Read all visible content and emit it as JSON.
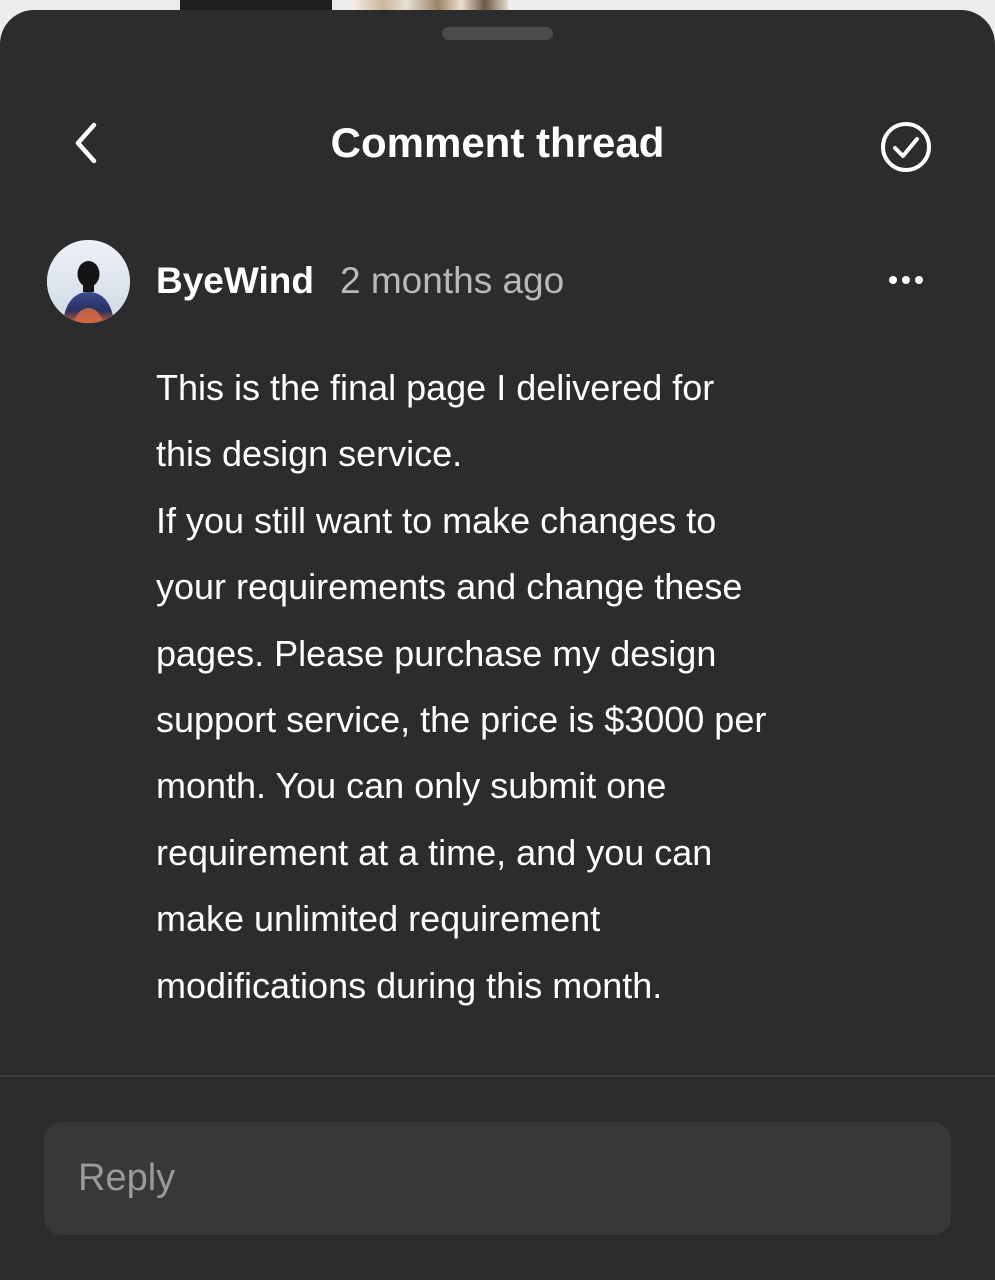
{
  "header": {
    "title": "Comment thread",
    "back_icon": "chevron-left-icon",
    "resolve_icon": "check-circle-icon"
  },
  "comment": {
    "author": "ByeWind",
    "time": "2 months ago",
    "more_icon": "more-horizontal-icon",
    "body_lines": [
      "This is the final page I delivered for",
      "this design service.",
      "If you still want to make changes to",
      "your requirements and change these",
      "pages. Please purchase my design",
      "support service, the price is $3000 per",
      "month. You can only submit one",
      "requirement at a time, and you can",
      "make unlimited requirement",
      "modifications during this month."
    ]
  },
  "reply": {
    "placeholder": "Reply",
    "value": ""
  },
  "colors": {
    "sheet_bg": "#2c2c2c",
    "input_bg": "#383838",
    "text_primary": "#ffffff",
    "text_secondary": "#b9b9b9"
  }
}
